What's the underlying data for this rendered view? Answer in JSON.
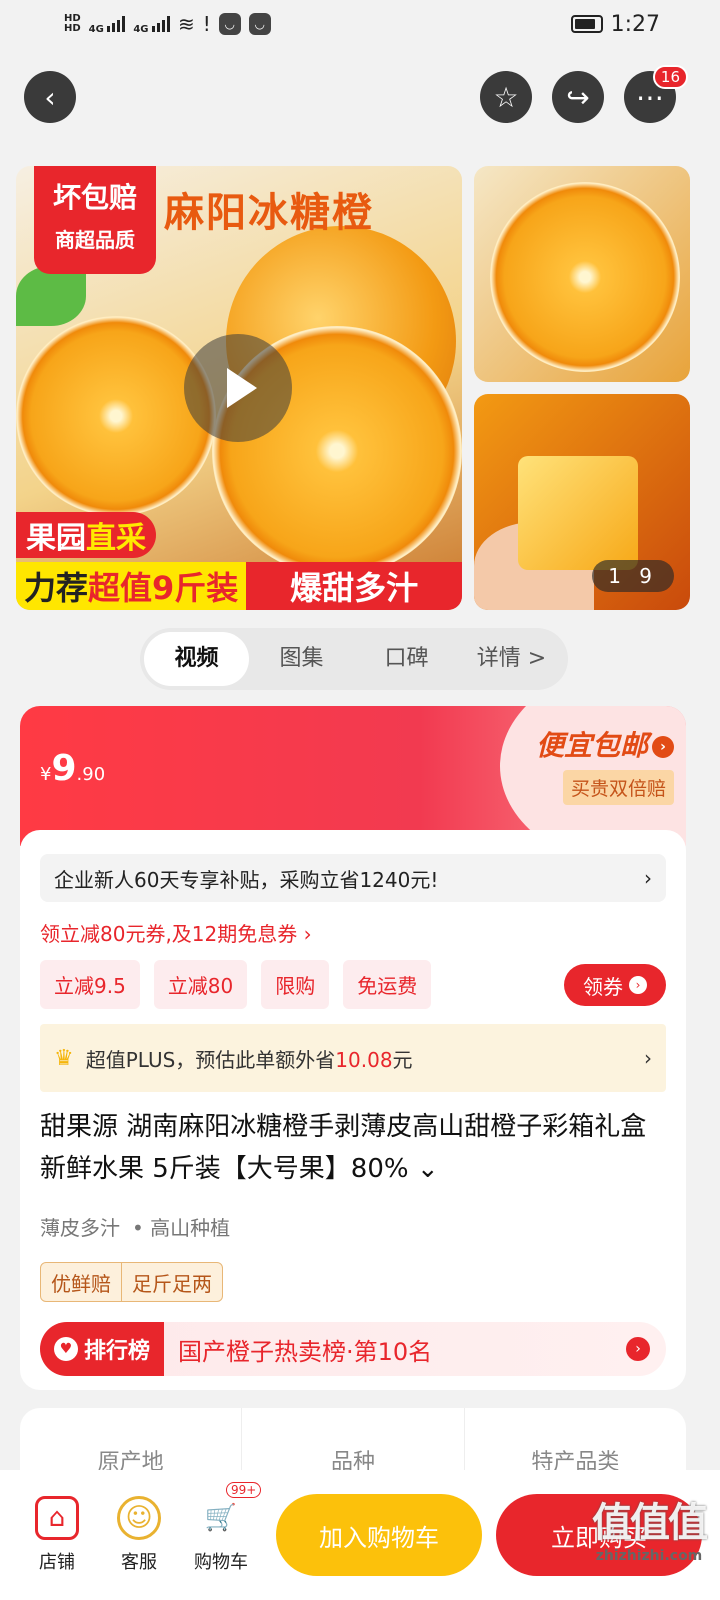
{
  "status": {
    "time": "1:27",
    "left_icons": [
      "HD1",
      "HD2",
      "4G",
      "4G"
    ]
  },
  "nav": {
    "back": "‹",
    "fav": "☆",
    "share": "↪",
    "more": "⋯",
    "more_badge": "16"
  },
  "gallery": {
    "main": {
      "badge_line1": "坏包赔",
      "badge_line2": "商超品质",
      "headline": "麻阳冰糖橙",
      "strip1_a": "果园",
      "strip1_b": "直采",
      "strip2_a": "力荐",
      "strip2_b": "超值9斤装",
      "strip2_c": "爆甜多汁"
    },
    "pager": "1 9"
  },
  "tabs": [
    "视频",
    "图集",
    "口碑",
    "详情 >"
  ],
  "price": {
    "symbol": "¥",
    "integer": "9",
    "decimal": ".90"
  },
  "promo": {
    "title": "便宜包邮",
    "sub": "买贵双倍赔"
  },
  "card": {
    "new_user": "企业新人60天专享补贴，采购立省1240元!",
    "coupon_link": "领立减80元券,及12期免息券 ›",
    "chips": [
      "立减9.5",
      "立减80",
      "限购",
      "免运费"
    ],
    "get_coupon": "领券",
    "plus_a": "超值PLUS，预估此单额外省",
    "plus_b": "10.08",
    "plus_c": "元",
    "title": "甜果源 湖南麻阳冰糖橙手剥薄皮高山甜橙子彩箱礼盒 新鲜水果 5斤装【大号果】80% ⌄",
    "sub1": "薄皮多汁",
    "sub2": "• 高山种植",
    "guar1": "优鲜赔",
    "guar2": "足斤足两",
    "rank_label": "排行榜",
    "rank_text": "国产橙子热卖榜·第10名"
  },
  "attrs": [
    "原产地",
    "品种",
    "特产品类"
  ],
  "bottom": {
    "shop": "店铺",
    "service": "客服",
    "cart": "购物车",
    "cart_badge": "99+",
    "add_cart": "加入购物车",
    "buy_now": "立即购买"
  },
  "watermark": {
    "logo": "值值值",
    "url": "zhizhizhi.com"
  },
  "colors": {
    "brand_red": "#e8262c",
    "yellow": "#fcc10b"
  }
}
